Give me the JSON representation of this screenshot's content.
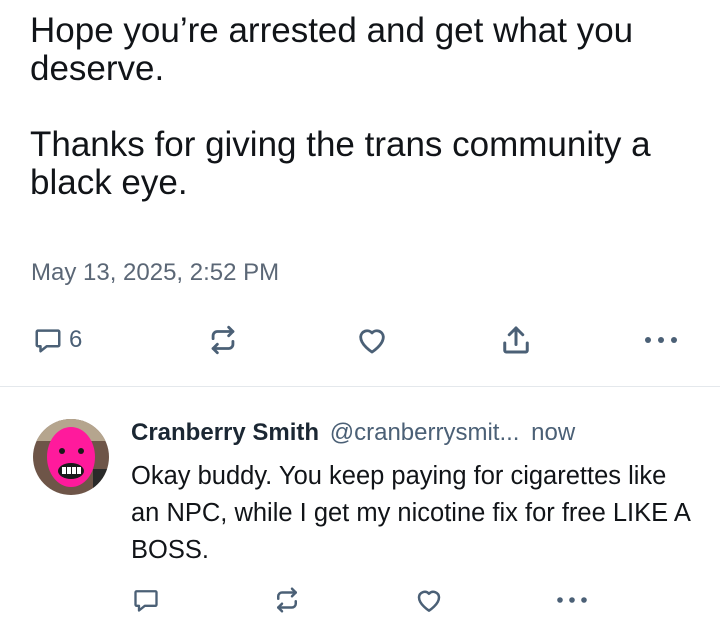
{
  "post": {
    "paragraphs": [
      "Hope you’re arrested and get what you deserve.",
      "Thanks for giving the trans community a black eye."
    ],
    "timestamp": "May 13, 2025, 2:52 PM",
    "actions": {
      "reply_icon": "speech-bubble-icon",
      "reply_count": "6",
      "repost_icon": "repost-arrows-icon",
      "like_icon": "heart-icon",
      "share_icon": "share-upload-icon",
      "more_icon": "more-dots-icon"
    }
  },
  "reply": {
    "avatar_icon": "pink-face-avatar",
    "author_name": "Cranberry Smith",
    "author_handle": "@cranberrysmit...",
    "time": "now",
    "text": "Okay buddy.  You keep paying for cigarettes like an NPC, while I get my nicotine fix for free LIKE A BOSS.",
    "actions": {
      "reply_icon": "speech-bubble-icon",
      "repost_icon": "repost-arrows-icon",
      "like_icon": "heart-icon",
      "more_icon": "more-dots-icon"
    }
  },
  "colors": {
    "text": "#111418",
    "muted": "#5b6776",
    "icon": "#4b6076",
    "divider": "#e4e8ec",
    "avatar_pink": "#ff1a9c"
  }
}
